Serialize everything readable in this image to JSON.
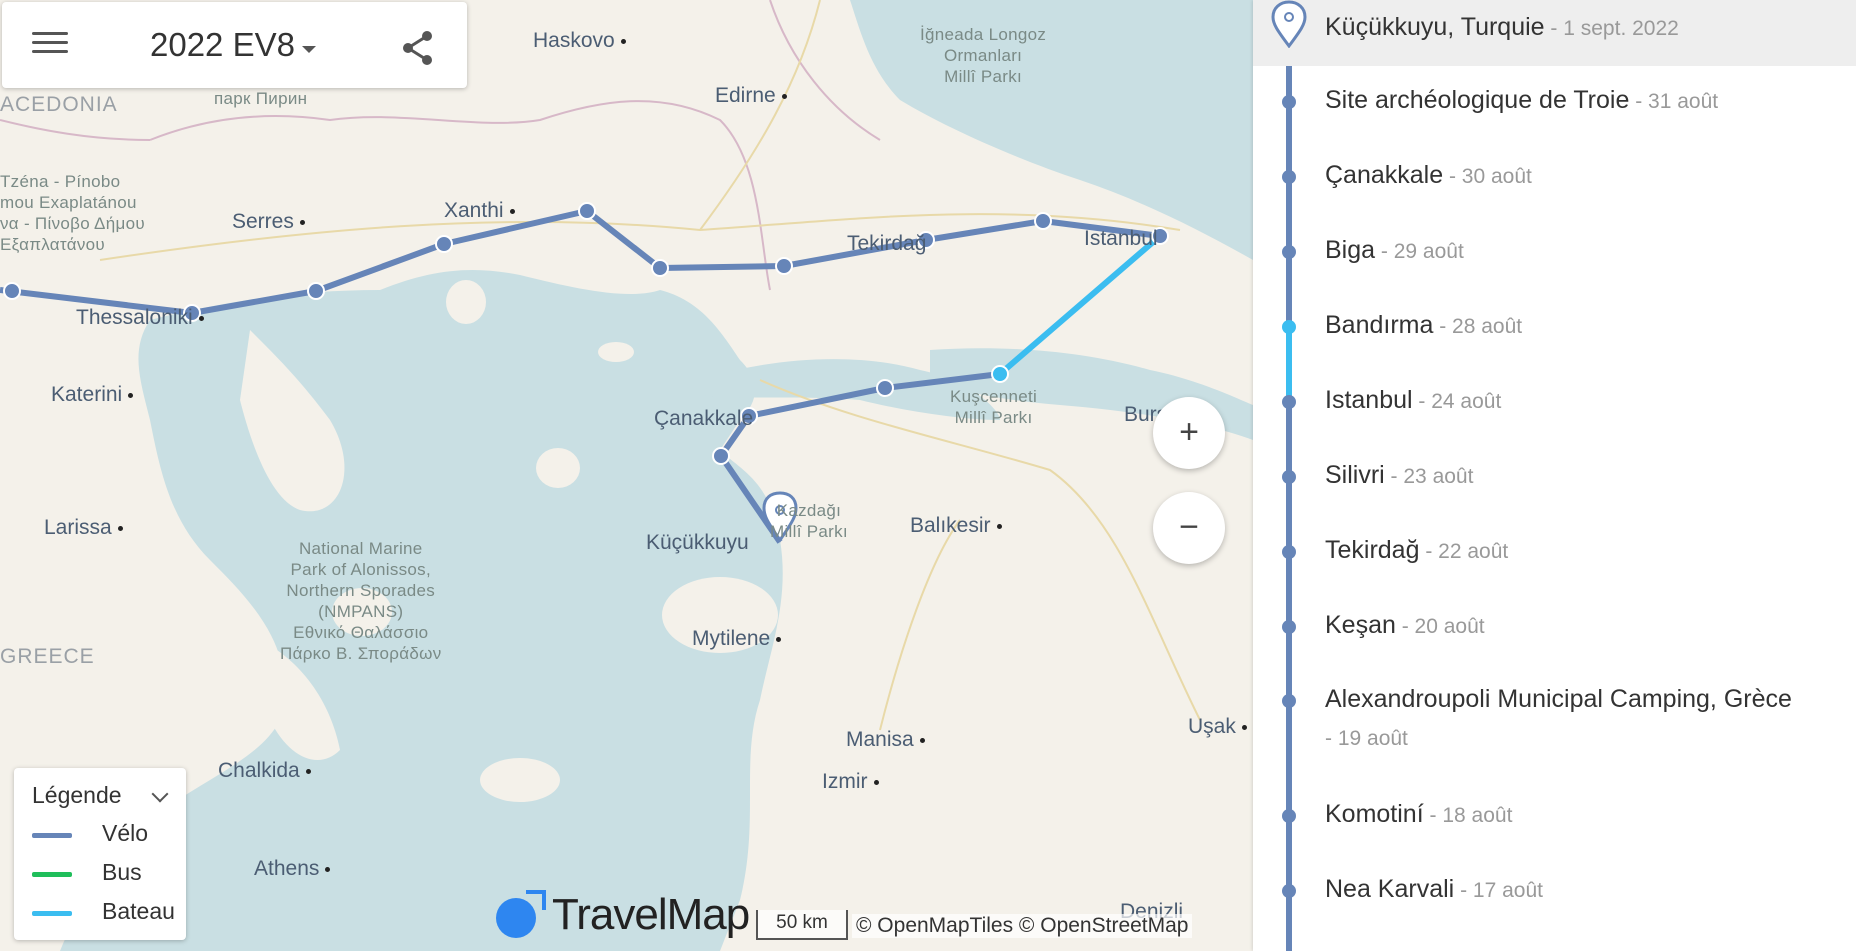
{
  "header": {
    "title": "2022 EV8"
  },
  "map": {
    "places": [
      {
        "name": "Haskovo"
      },
      {
        "name": "Edirne"
      },
      {
        "name": "Serres"
      },
      {
        "name": "Xanthi"
      },
      {
        "name": "Thessaloniki"
      },
      {
        "name": "Tekirdağ"
      },
      {
        "name": "Istanbul"
      },
      {
        "name": "Katerini"
      },
      {
        "name": "Çanakkale"
      },
      {
        "name": "Larissa"
      },
      {
        "name": "Küçükkuyu"
      },
      {
        "name": "Balıkesir"
      },
      {
        "name": "Bursa"
      },
      {
        "name": "Mytilene"
      },
      {
        "name": "Manisa"
      },
      {
        "name": "Izmir"
      },
      {
        "name": "Chalkida"
      },
      {
        "name": "Athens"
      },
      {
        "name": "Uşak"
      },
      {
        "name": "Denizli"
      }
    ],
    "parks": [
      {
        "text": "İğneada Longoz\nOrmanları\nMillî Parkı"
      },
      {
        "text": "парк Пирин"
      },
      {
        "text": "Tzéna - Pínobo\nmou Exaplatánou\nνα - Πίνοβο Δήμου\nΕξαπλατάνου"
      },
      {
        "text": "Kuşcenneti\nMillî Parkı"
      },
      {
        "text": "Kazdağı\nMillî Parkı"
      },
      {
        "text": "National Marine\nPark of Alonissos,\nNorthern Sporades\n(NMPANS)\nΕθνικό Θαλάσσιο\nΠάρκο Β. Σποράδων"
      }
    ],
    "countries": [
      {
        "name": "ACEDONIA"
      },
      {
        "name": "GREECE"
      }
    ],
    "zoom_in": "+",
    "zoom_out": "−",
    "scale": "50 km",
    "attribution": "© OpenMapTiles © OpenStreetMap",
    "brand": "TravelMap"
  },
  "legend": {
    "title": "Légende",
    "items": [
      {
        "label": "Vélo",
        "color": "#6685b8"
      },
      {
        "label": "Bus",
        "color": "#1fbe5a"
      },
      {
        "label": "Bateau",
        "color": "#3bbdf0"
      }
    ]
  },
  "stops": [
    {
      "name": "Küçükkuyu, Turquie",
      "date": " - 1 sept. 2022"
    },
    {
      "name": "Site archéologique de Troie",
      "date": " - 31 août"
    },
    {
      "name": "Çanakkale",
      "date": " - 30 août"
    },
    {
      "name": "Biga",
      "date": " - 29 août"
    },
    {
      "name": "Bandırma",
      "date": " - 28 août"
    },
    {
      "name": "Istanbul",
      "date": " - 24 août"
    },
    {
      "name": "Silivri",
      "date": " - 23 août"
    },
    {
      "name": "Tekirdağ",
      "date": " - 22 août"
    },
    {
      "name": "Keşan",
      "date": " - 20 août"
    },
    {
      "name": "Alexandroupoli Municipal Camping, Grèce",
      "date": "- 19 août"
    },
    {
      "name": "Komotiní",
      "date": " - 18 août"
    },
    {
      "name": "Nea Karvali",
      "date": " - 17 août"
    }
  ]
}
